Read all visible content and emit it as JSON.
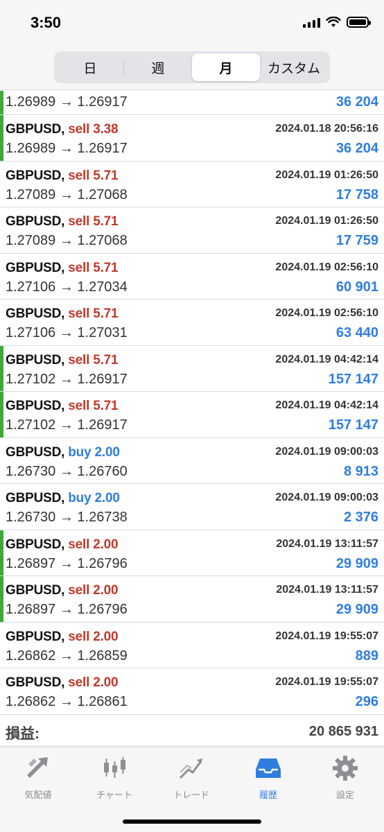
{
  "status_bar": {
    "time": "3:50"
  },
  "segments": [
    {
      "label": "日",
      "active": false
    },
    {
      "label": "週",
      "active": false
    },
    {
      "label": "月",
      "active": true
    },
    {
      "label": "カスタム",
      "active": false
    }
  ],
  "partial_row": {
    "prices": "1.26989 → 1.26917",
    "profit": "36 204"
  },
  "deals": [
    {
      "symbol": "GBPUSD,",
      "direction": "sell 3.38",
      "side": "sell",
      "time": "2024.01.18 20:56:16",
      "prices": "1.26989 → 1.26917",
      "profit": "36 204",
      "marker": true
    },
    {
      "symbol": "GBPUSD,",
      "direction": "sell 5.71",
      "side": "sell",
      "time": "2024.01.19 01:26:50",
      "prices": "1.27089 → 1.27068",
      "profit": "17 758",
      "marker": false
    },
    {
      "symbol": "GBPUSD,",
      "direction": "sell 5.71",
      "side": "sell",
      "time": "2024.01.19 01:26:50",
      "prices": "1.27089 → 1.27068",
      "profit": "17 759",
      "marker": false
    },
    {
      "symbol": "GBPUSD,",
      "direction": "sell 5.71",
      "side": "sell",
      "time": "2024.01.19 02:56:10",
      "prices": "1.27106 → 1.27034",
      "profit": "60 901",
      "marker": false
    },
    {
      "symbol": "GBPUSD,",
      "direction": "sell 5.71",
      "side": "sell",
      "time": "2024.01.19 02:56:10",
      "prices": "1.27106 → 1.27031",
      "profit": "63 440",
      "marker": false
    },
    {
      "symbol": "GBPUSD,",
      "direction": "sell 5.71",
      "side": "sell",
      "time": "2024.01.19 04:42:14",
      "prices": "1.27102 → 1.26917",
      "profit": "157 147",
      "marker": true
    },
    {
      "symbol": "GBPUSD,",
      "direction": "sell 5.71",
      "side": "sell",
      "time": "2024.01.19 04:42:14",
      "prices": "1.27102 → 1.26917",
      "profit": "157 147",
      "marker": true
    },
    {
      "symbol": "GBPUSD,",
      "direction": "buy 2.00",
      "side": "buy",
      "time": "2024.01.19 09:00:03",
      "prices": "1.26730 → 1.26760",
      "profit": "8 913",
      "marker": false
    },
    {
      "symbol": "GBPUSD,",
      "direction": "buy 2.00",
      "side": "buy",
      "time": "2024.01.19 09:00:03",
      "prices": "1.26730 → 1.26738",
      "profit": "2 376",
      "marker": false
    },
    {
      "symbol": "GBPUSD,",
      "direction": "sell 2.00",
      "side": "sell",
      "time": "2024.01.19 13:11:57",
      "prices": "1.26897 → 1.26796",
      "profit": "29 909",
      "marker": true
    },
    {
      "symbol": "GBPUSD,",
      "direction": "sell 2.00",
      "side": "sell",
      "time": "2024.01.19 13:11:57",
      "prices": "1.26897 → 1.26796",
      "profit": "29 909",
      "marker": true
    },
    {
      "symbol": "GBPUSD,",
      "direction": "sell 2.00",
      "side": "sell",
      "time": "2024.01.19 19:55:07",
      "prices": "1.26862 → 1.26859",
      "profit": "889",
      "marker": false
    },
    {
      "symbol": "GBPUSD,",
      "direction": "sell 2.00",
      "side": "sell",
      "time": "2024.01.19 19:55:07",
      "prices": "1.26862 → 1.26861",
      "profit": "296",
      "marker": false
    }
  ],
  "total": {
    "label": "損益:",
    "value": "20 865 931"
  },
  "tabs": [
    {
      "label": "気配値",
      "icon": "quotes-icon",
      "active": false
    },
    {
      "label": "チャート",
      "icon": "chart-icon",
      "active": false
    },
    {
      "label": "トレード",
      "icon": "trade-icon",
      "active": false
    },
    {
      "label": "履歴",
      "icon": "history-icon",
      "active": true
    },
    {
      "label": "設定",
      "icon": "settings-icon",
      "active": false
    }
  ],
  "colors": {
    "sell": "#c0392b",
    "buy": "#2f7de1",
    "profit": "#2f7de1",
    "marker": "#3ea83a",
    "active_tab": "#2f7de1"
  }
}
